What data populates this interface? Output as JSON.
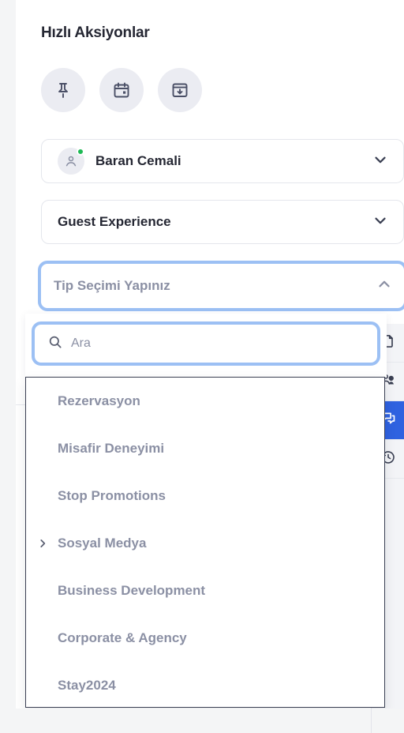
{
  "panel": {
    "title": "Hızlı Aksiyonlar"
  },
  "quick_actions": [
    {
      "name": "pin",
      "icon": "pin-icon",
      "label": "Pin"
    },
    {
      "name": "calendar",
      "icon": "calendar-icon",
      "label": "Calendar"
    },
    {
      "name": "archive",
      "icon": "archive-download-icon",
      "label": "Archive"
    }
  ],
  "selects": {
    "assignee": {
      "value": "Baran Cemali",
      "icon": "user-avatar-icon",
      "status": "online",
      "chevron": "chevron-down-icon"
    },
    "department": {
      "value": "Guest Experience",
      "chevron": "chevron-down-icon"
    },
    "type": {
      "value": "Tip Seçimi Yapınız",
      "chevron": "chevron-up-icon",
      "expanded": "true"
    }
  },
  "dropdown": {
    "search": {
      "placeholder": "Ara",
      "value": "",
      "icon": "search-icon"
    },
    "items": [
      {
        "label": "Rezervasyon",
        "expandable": false
      },
      {
        "label": "Misafir Deneyimi",
        "expandable": false
      },
      {
        "label": "Stop Promotions",
        "expandable": false
      },
      {
        "label": "Sosyal Medya",
        "expandable": true
      },
      {
        "label": "Business Development",
        "expandable": false
      },
      {
        "label": "Corporate & Agency",
        "expandable": false
      },
      {
        "label": "Stay2024",
        "expandable": false
      }
    ],
    "expand_icon": "chevron-right-icon"
  },
  "rail": {
    "items": [
      {
        "icon": "document-icon",
        "active": false
      },
      {
        "icon": "users-icon",
        "active": false
      },
      {
        "icon": "chat-icon",
        "active": true
      },
      {
        "icon": "history-clock-icon",
        "active": false
      }
    ]
  },
  "colors": {
    "accent": "#2f62e0",
    "focus_ring": "#9cc0f4",
    "online": "#1db954",
    "muted_text": "#8b90a4",
    "strong_text": "#252733",
    "panel_bg": "#ffffff",
    "page_bg": "#f4f5f6"
  }
}
